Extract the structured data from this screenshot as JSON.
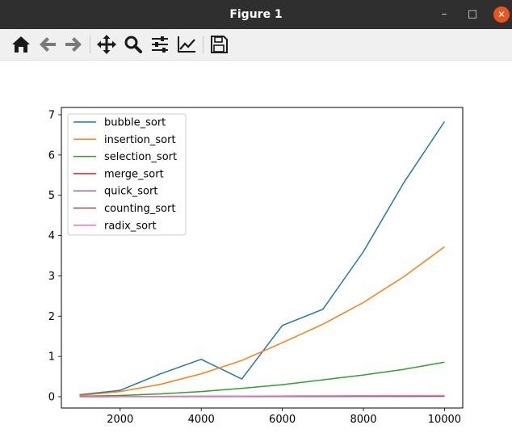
{
  "window": {
    "title": "Figure 1",
    "minimize_glyph": "–",
    "maximize_glyph": "□",
    "close_glyph": "✕"
  },
  "toolbar": {
    "buttons": [
      {
        "icon": "home-icon"
      },
      {
        "icon": "back-arrow-icon"
      },
      {
        "icon": "forward-arrow-icon"
      },
      {
        "icon": "pan-icon"
      },
      {
        "icon": "zoom-icon"
      },
      {
        "icon": "configure-subplots-icon"
      },
      {
        "icon": "edit-axis-icon"
      },
      {
        "icon": "save-icon"
      }
    ]
  },
  "chart_data": {
    "type": "line",
    "title": "",
    "xlabel": "",
    "ylabel": "",
    "x": [
      1000,
      2000,
      3000,
      4000,
      5000,
      6000,
      7000,
      8000,
      9000,
      10000
    ],
    "xlim": [
      550,
      10450
    ],
    "ylim": [
      -0.28,
      7.18
    ],
    "xticks": [
      2000,
      4000,
      6000,
      8000,
      10000
    ],
    "yticks": [
      0,
      1,
      2,
      3,
      4,
      5,
      6,
      7
    ],
    "grid": false,
    "legend_position": "top-left",
    "series": [
      {
        "name": "bubble_sort",
        "color": "#1f77b4",
        "values": [
          0.05,
          0.16,
          0.57,
          0.93,
          0.44,
          1.77,
          2.17,
          3.6,
          5.32,
          6.83
        ]
      },
      {
        "name": "insertion_sort",
        "color": "#ff7f0e",
        "values": [
          0.03,
          0.13,
          0.31,
          0.57,
          0.9,
          1.34,
          1.8,
          2.34,
          2.98,
          3.72
        ]
      },
      {
        "name": "selection_sort",
        "color": "#2ca02c",
        "values": [
          0.01,
          0.03,
          0.07,
          0.13,
          0.21,
          0.3,
          0.42,
          0.54,
          0.68,
          0.86
        ]
      },
      {
        "name": "merge_sort",
        "color": "#d62728",
        "values": [
          0.002,
          0.005,
          0.007,
          0.01,
          0.012,
          0.015,
          0.018,
          0.021,
          0.024,
          0.027
        ]
      },
      {
        "name": "quick_sort",
        "color": "#9467bd",
        "values": [
          0.002,
          0.004,
          0.006,
          0.008,
          0.01,
          0.012,
          0.014,
          0.017,
          0.019,
          0.021
        ]
      },
      {
        "name": "counting_sort",
        "color": "#8c564b",
        "values": [
          0.001,
          0.002,
          0.003,
          0.004,
          0.005,
          0.006,
          0.007,
          0.008,
          0.009,
          0.01
        ]
      },
      {
        "name": "radix_sort",
        "color": "#e377c2",
        "values": [
          0.003,
          0.006,
          0.009,
          0.012,
          0.015,
          0.018,
          0.021,
          0.024,
          0.028,
          0.031
        ]
      }
    ]
  }
}
